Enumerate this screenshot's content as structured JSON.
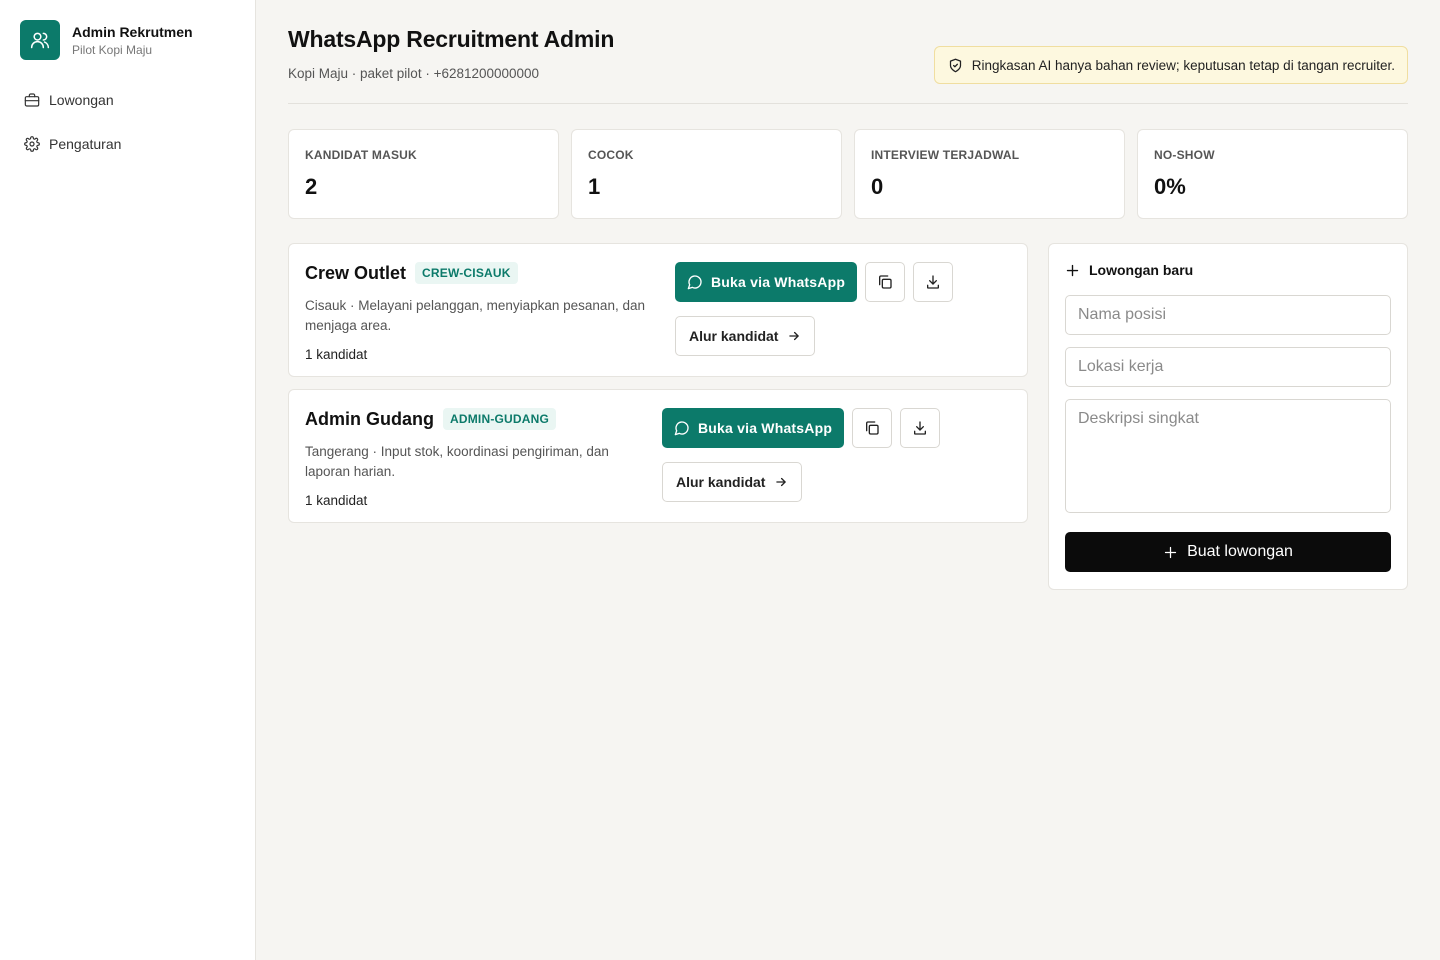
{
  "sidebar": {
    "brand_title": "Admin Rekrutmen",
    "brand_subtitle": "Pilot Kopi Maju",
    "items": [
      {
        "label": "Lowongan",
        "icon": "briefcase-icon"
      },
      {
        "label": "Pengaturan",
        "icon": "gear-icon"
      }
    ]
  },
  "header": {
    "title": "WhatsApp Recruitment Admin",
    "subtitle": "Kopi Maju · paket pilot · +6281200000000",
    "notice": "Ringkasan AI hanya bahan review; keputusan tetap di tangan recruiter."
  },
  "stats": [
    {
      "label": "KANDIDAT MASUK",
      "value": "2"
    },
    {
      "label": "COCOK",
      "value": "1"
    },
    {
      "label": "INTERVIEW TERJADWAL",
      "value": "0"
    },
    {
      "label": "NO-SHOW",
      "value": "0%"
    }
  ],
  "jobs": [
    {
      "title": "Crew Outlet",
      "code": "CREW-CISAUK",
      "description": "Cisauk · Melayani pelanggan, menyiapkan pesanan, dan menjaga area.",
      "count": "1 kandidat",
      "whatsapp_label": "Buka via WhatsApp",
      "flow_label": "Alur kandidat"
    },
    {
      "title": "Admin Gudang",
      "code": "ADMIN-GUDANG",
      "description": "Tangerang · Input stok, koordinasi pengiriman, dan laporan harian.",
      "count": "1 kandidat",
      "whatsapp_label": "Buka via WhatsApp",
      "flow_label": "Alur kandidat"
    }
  ],
  "new_job": {
    "title": "Lowongan baru",
    "position_placeholder": "Nama posisi",
    "location_placeholder": "Lokasi kerja",
    "description_placeholder": "Deskripsi singkat",
    "submit_label": "Buat lowongan"
  },
  "colors": {
    "accent": "#0c7a6a",
    "notice_bg": "#fdf8df",
    "primary_dark": "#0b0b0b"
  }
}
